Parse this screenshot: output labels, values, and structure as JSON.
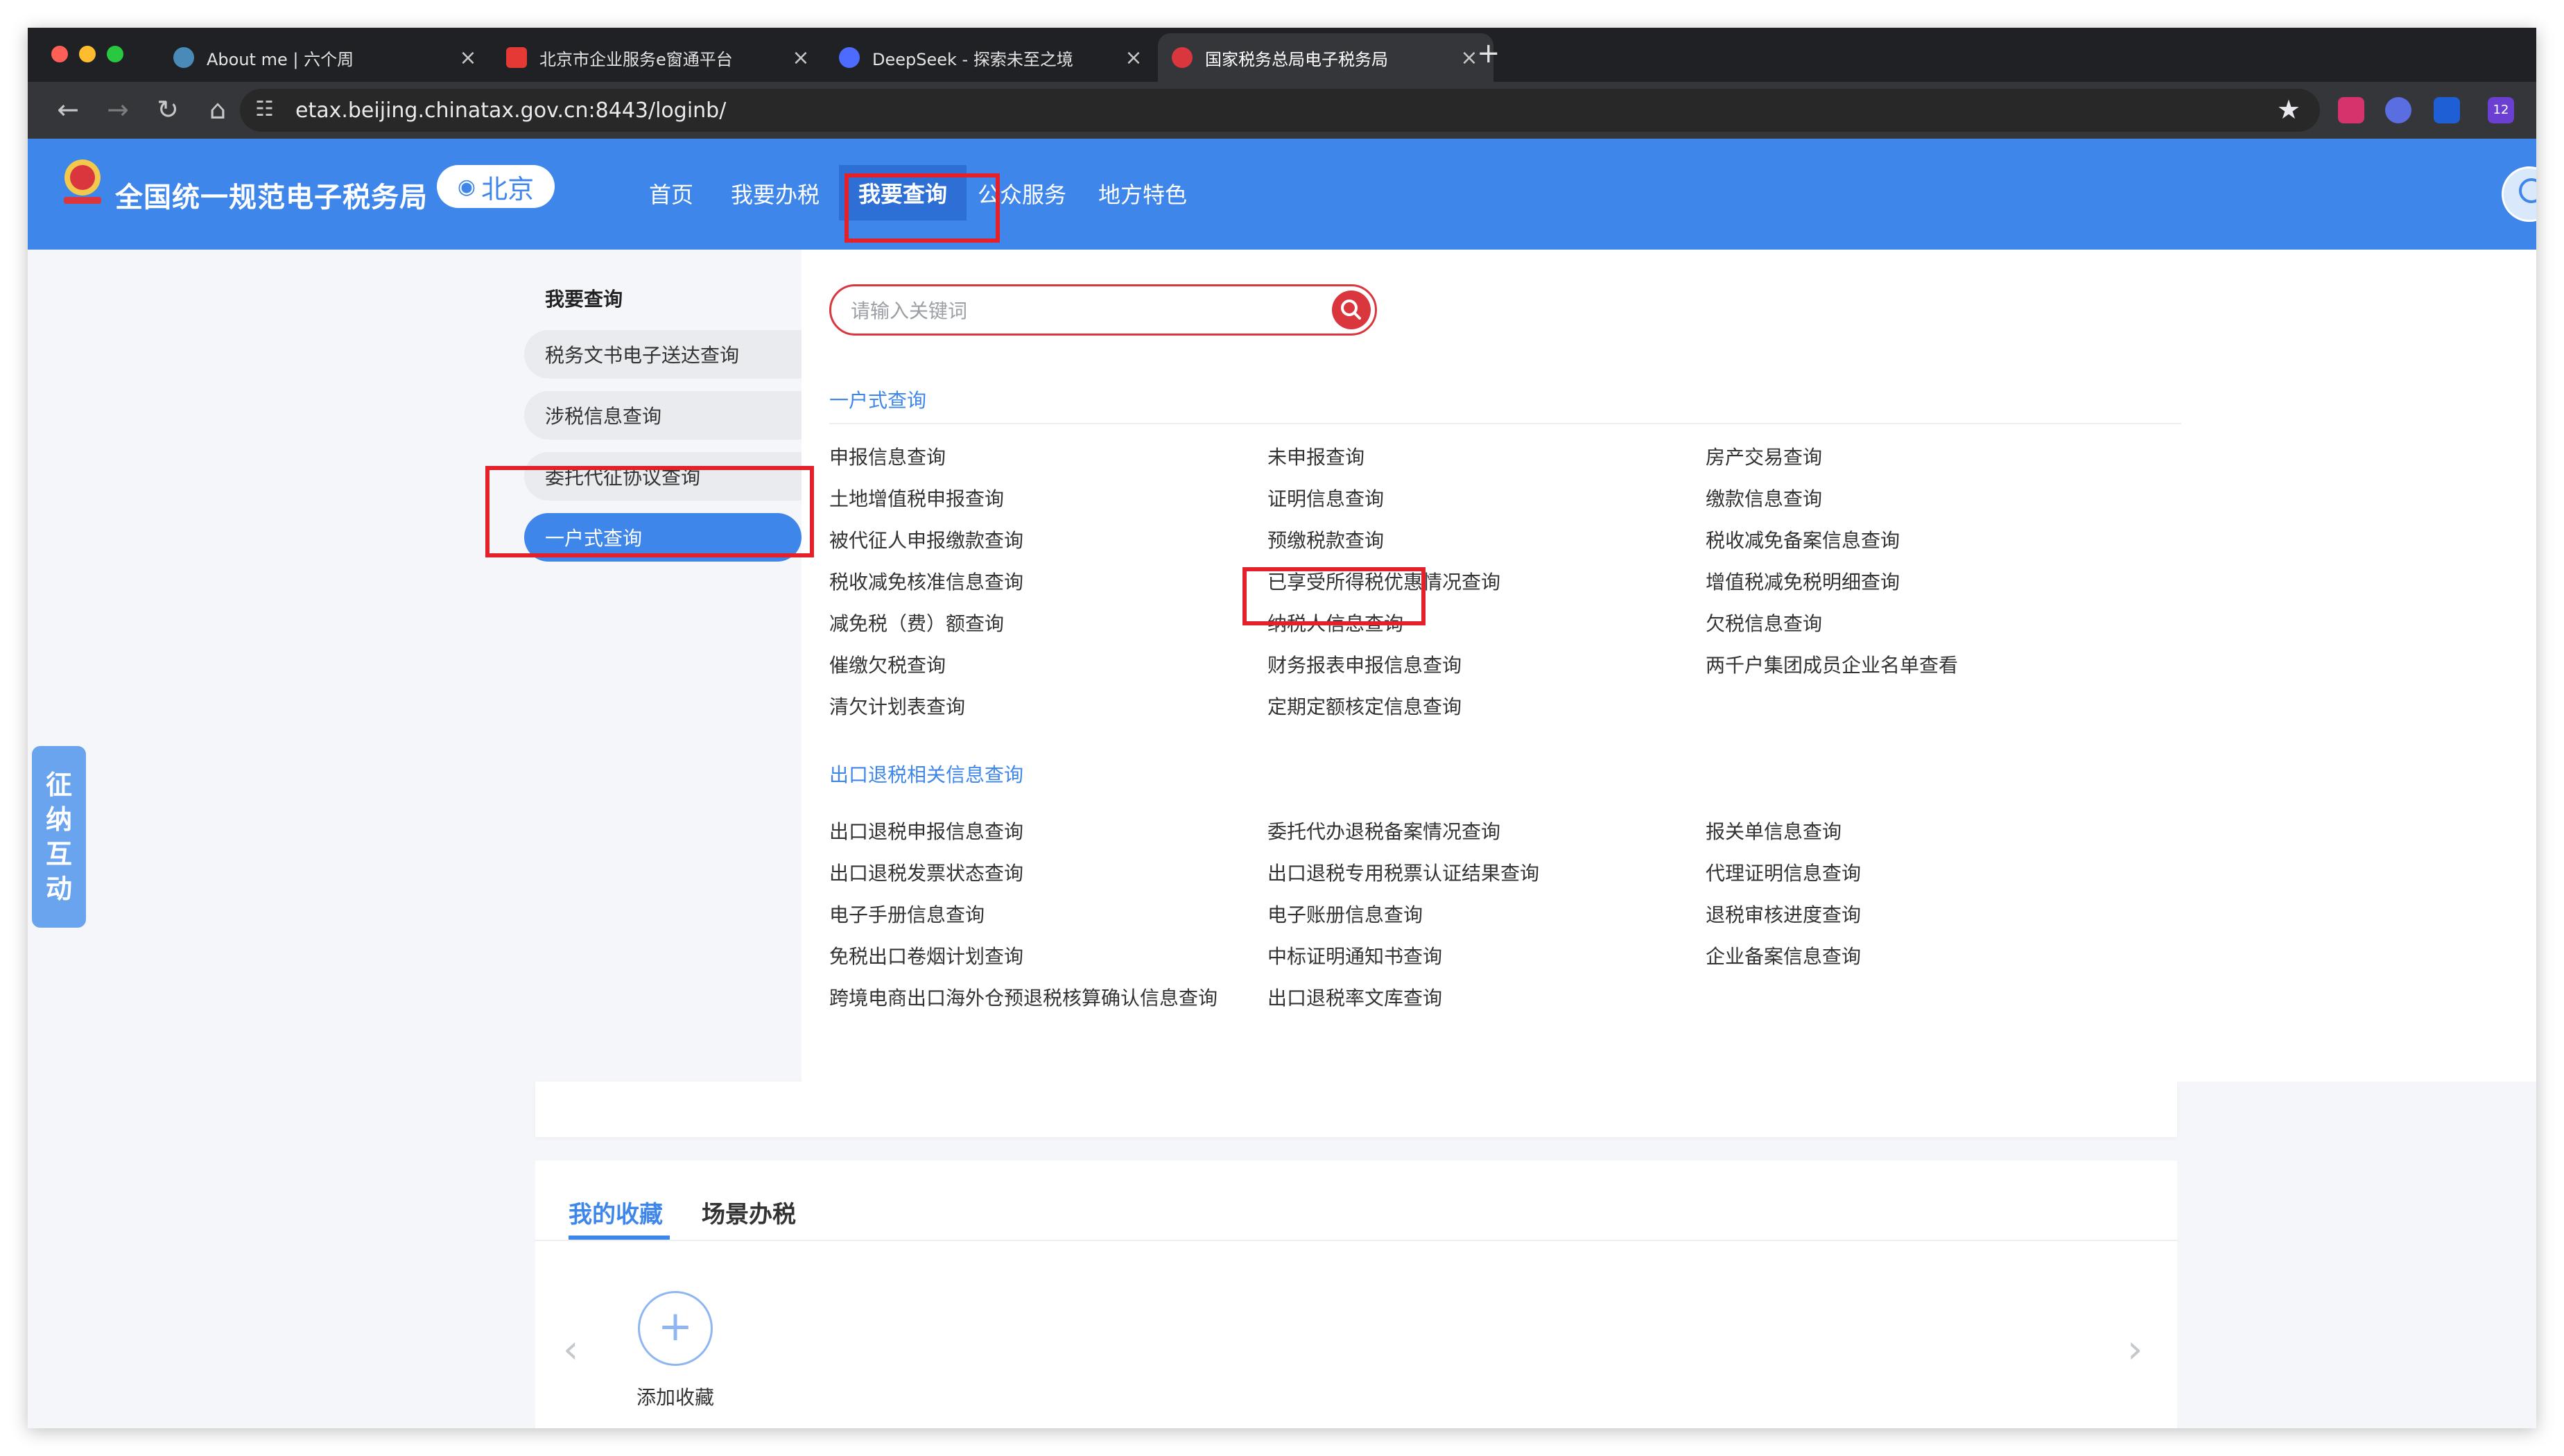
{
  "browser": {
    "tabs": [
      {
        "title": "About me | 六个周",
        "favicon_color": "#4a8ab8"
      },
      {
        "title": "北京市企业服务e窗通平台",
        "favicon_color": "#e53935"
      },
      {
        "title": "DeepSeek - 探索未至之境",
        "favicon_color": "#4d6bfe"
      },
      {
        "title": "国家税务总局电子税务局",
        "favicon_color": "#d9363e"
      }
    ],
    "new_tab": "+",
    "tab_close": "×",
    "url": "etax.beijing.chinatax.gov.cn:8443/loginb/",
    "extension_badge": "12"
  },
  "site": {
    "title": "全国统一规范电子税务局",
    "region": "北京",
    "nav": [
      "首页",
      "我要办税",
      "我要查询",
      "公众服务",
      "地方特色"
    ],
    "active_nav": "我要查询"
  },
  "sidebar": {
    "heading": "我要查询",
    "items": [
      "税务文书电子送达查询",
      "涉税信息查询",
      "委托代征协议查询",
      "一户式查询"
    ],
    "active_item": "一户式查询"
  },
  "search": {
    "placeholder": "请输入关键词"
  },
  "sections": [
    {
      "title": "一户式查询",
      "columns": [
        [
          "申报信息查询",
          "土地增值税申报查询",
          "被代征人申报缴款查询",
          "税收减免核准信息查询",
          "减免税（费）额查询",
          "催缴欠税查询",
          "清欠计划表查询"
        ],
        [
          "未申报查询",
          "证明信息查询",
          "预缴税款查询",
          "已享受所得税优惠情况查询",
          "纳税人信息查询",
          "财务报表申报信息查询",
          "定期定额核定信息查询"
        ],
        [
          "房产交易查询",
          "缴款信息查询",
          "税收减免备案信息查询",
          "增值税减免税明细查询",
          "欠税信息查询",
          "两千户集团成员企业名单查看"
        ]
      ]
    },
    {
      "title": "出口退税相关信息查询",
      "columns": [
        [
          "出口退税申报信息查询",
          "出口退税发票状态查询",
          "电子手册信息查询",
          "免税出口卷烟计划查询",
          "跨境电商出口海外仓预退税核算确认信息查询"
        ],
        [
          "委托代办退税备案情况查询",
          "出口退税专用税票认证结果查询",
          "电子账册信息查询",
          "中标证明通知书查询",
          "出口退税率文库查询"
        ],
        [
          "报关单信息查询",
          "代理证明信息查询",
          "退税审核进度查询",
          "企业备案信息查询"
        ]
      ]
    }
  ],
  "highlighted_link": "纳税人信息查询",
  "favorites": {
    "tabs": [
      "我的收藏",
      "场景办税"
    ],
    "add_label": "添加收藏",
    "add_symbol": "+",
    "prev": "‹",
    "next": "›"
  },
  "side_float": [
    "征",
    "纳",
    "互",
    "动"
  ],
  "colors": {
    "primary": "#3e86e9",
    "highlight_red": "#e4202a",
    "search_red": "#d9363e"
  }
}
